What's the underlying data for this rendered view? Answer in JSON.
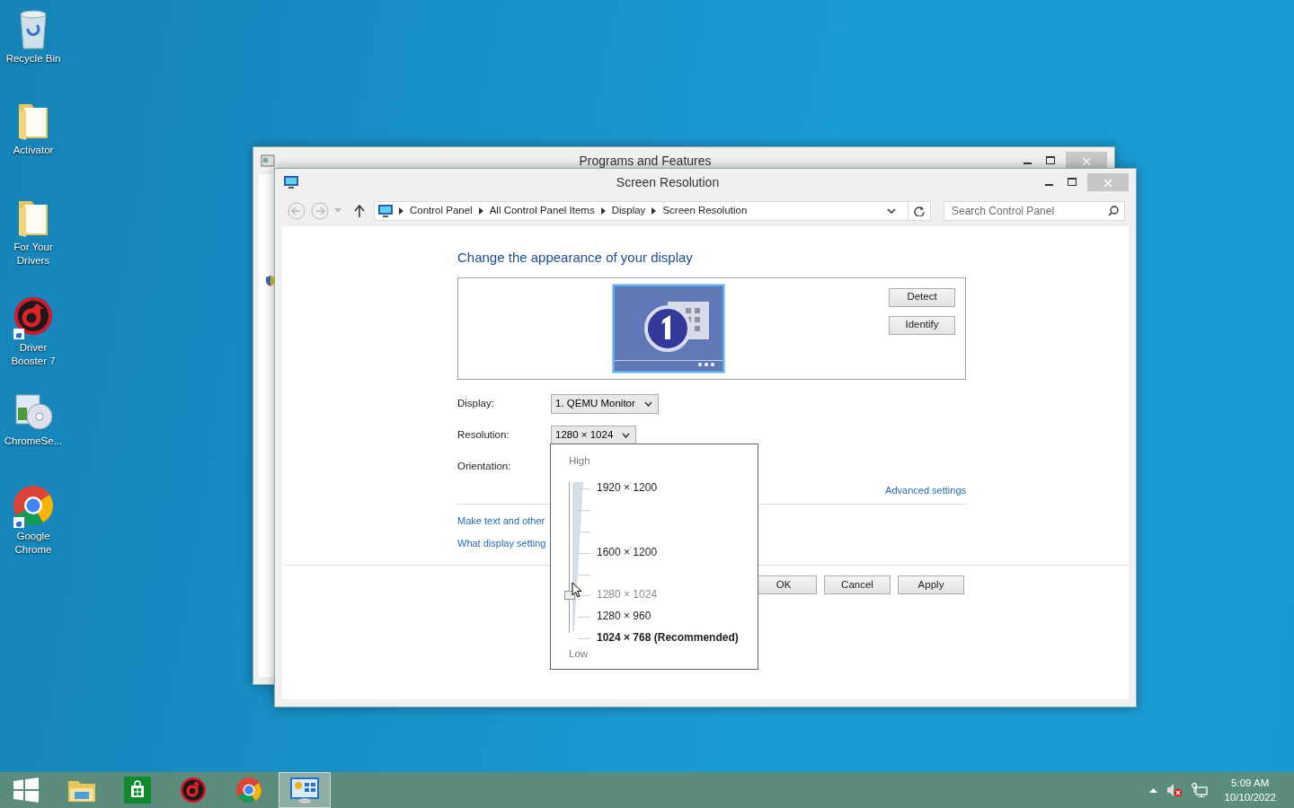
{
  "desktop_icons": [
    {
      "label": "Recycle Bin",
      "kind": "bin",
      "shortcut": false
    },
    {
      "label": "Activator",
      "kind": "folder",
      "shortcut": false
    },
    {
      "label": "For Your Drivers",
      "kind": "folder",
      "shortcut": false
    },
    {
      "label": "Driver Booster 7",
      "kind": "booster",
      "shortcut": true
    },
    {
      "label": "ChromeSe...",
      "kind": "setup",
      "shortcut": false
    },
    {
      "label": "Google Chrome",
      "kind": "chrome",
      "shortcut": true
    }
  ],
  "back_window": {
    "title": "Programs and Features"
  },
  "window": {
    "title": "Screen Resolution",
    "address": {
      "path": [
        "Control Panel",
        "All Control Panel Items",
        "Display",
        "Screen Resolution"
      ],
      "search_placeholder": "Search Control Panel"
    },
    "heading": "Change the appearance of your display",
    "side_buttons": [
      "Detect",
      "Identify"
    ],
    "fields": [
      {
        "label": "Display:",
        "value": "1. QEMU Monitor"
      },
      {
        "label": "Resolution:",
        "value": "1280 × 1024"
      },
      {
        "label": "Orientation:"
      }
    ],
    "advanced_link": "Advanced settings",
    "links": [
      "Make text and other",
      "What display setting"
    ],
    "buttons": [
      "OK",
      "Cancel",
      "Apply"
    ]
  },
  "resolution_popup": {
    "high_label": "High",
    "low_label": "Low",
    "options": [
      {
        "label": "1920 × 1200",
        "selected": false,
        "recommended": false
      },
      {
        "label": "1600 × 1200",
        "selected": false,
        "recommended": false
      },
      {
        "label": "1280 × 1024",
        "selected": true,
        "recommended": false
      },
      {
        "label": "1280 × 960",
        "selected": false,
        "recommended": false
      },
      {
        "label": "1024 × 768 (Recommended)",
        "selected": false,
        "recommended": true
      }
    ]
  },
  "taskbar": {
    "apps": [
      {
        "kind": "start",
        "active": false
      },
      {
        "kind": "explorer",
        "active": false
      },
      {
        "kind": "store",
        "active": false
      },
      {
        "kind": "booster",
        "active": false
      },
      {
        "kind": "chrome",
        "active": false
      },
      {
        "kind": "control",
        "active": true
      }
    ],
    "time": "5:09 AM",
    "date": "10/10/2022"
  }
}
